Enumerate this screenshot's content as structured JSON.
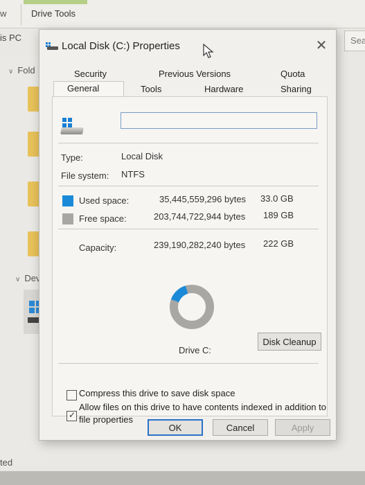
{
  "explorer": {
    "ribbon_view_tab": "w",
    "ribbon_tools_tab": "Drive Tools",
    "address_text": "is PC",
    "search_placeholder": "Sea",
    "nav_folders_label": "Fold",
    "nav_devices_label": "Dev",
    "status_text": "ted"
  },
  "dialog": {
    "title": "Local Disk (C:) Properties",
    "tabs_top": [
      "Security",
      "Previous Versions",
      "Quota"
    ],
    "tabs_bottom": [
      "General",
      "Tools",
      "Hardware",
      "Sharing"
    ],
    "active_tab": "General",
    "drive_name_value": "",
    "type_label": "Type:",
    "type_value": "Local Disk",
    "fs_label": "File system:",
    "fs_value": "NTFS",
    "used_label": "Used space:",
    "used_bytes": "35,445,559,296 bytes",
    "used_gb": "33.0 GB",
    "free_label": "Free space:",
    "free_bytes": "203,744,722,944 bytes",
    "free_gb": "189 GB",
    "capacity_label": "Capacity:",
    "capacity_bytes": "239,190,282,240 bytes",
    "capacity_gb": "222 GB",
    "drive_label": "Drive C:",
    "cleanup_button": "Disk Cleanup",
    "compress_label": "Compress this drive to save disk space",
    "compress_checked": false,
    "index_label_line1": "Allow files on this drive to have contents indexed in addition to",
    "index_label_line2": "file properties",
    "index_checked": true,
    "ok_button": "OK",
    "cancel_button": "Cancel",
    "apply_button": "Apply",
    "used_fraction": 0.148,
    "colors": {
      "used": "#1a8ad8",
      "free": "#a8a7a4",
      "accent": "#2a71c7"
    }
  }
}
